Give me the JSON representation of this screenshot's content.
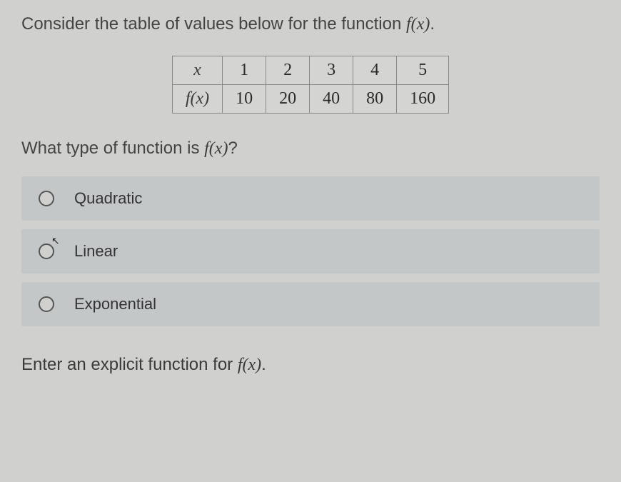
{
  "intro_prefix": "Consider the table of values below for the function ",
  "intro_fn": "f(x)",
  "intro_suffix": ".",
  "table": {
    "header_label_x": "x",
    "header_label_fx": "f(x)",
    "x_values": [
      "1",
      "2",
      "3",
      "4",
      "5"
    ],
    "fx_values": [
      "10",
      "20",
      "40",
      "80",
      "160"
    ]
  },
  "subquestion_prefix": "What type of function is ",
  "subquestion_fn": "f(x)",
  "subquestion_suffix": "?",
  "options": [
    {
      "label": "Quadratic"
    },
    {
      "label": "Linear"
    },
    {
      "label": "Exponential"
    }
  ],
  "enter_prompt_prefix": "Enter an explicit function for ",
  "enter_prompt_fn": "f(x)",
  "enter_prompt_suffix": ".",
  "chart_data": {
    "type": "table",
    "categories": [
      1,
      2,
      3,
      4,
      5
    ],
    "values": [
      10,
      20,
      40,
      80,
      160
    ],
    "xlabel": "x",
    "ylabel": "f(x)"
  }
}
